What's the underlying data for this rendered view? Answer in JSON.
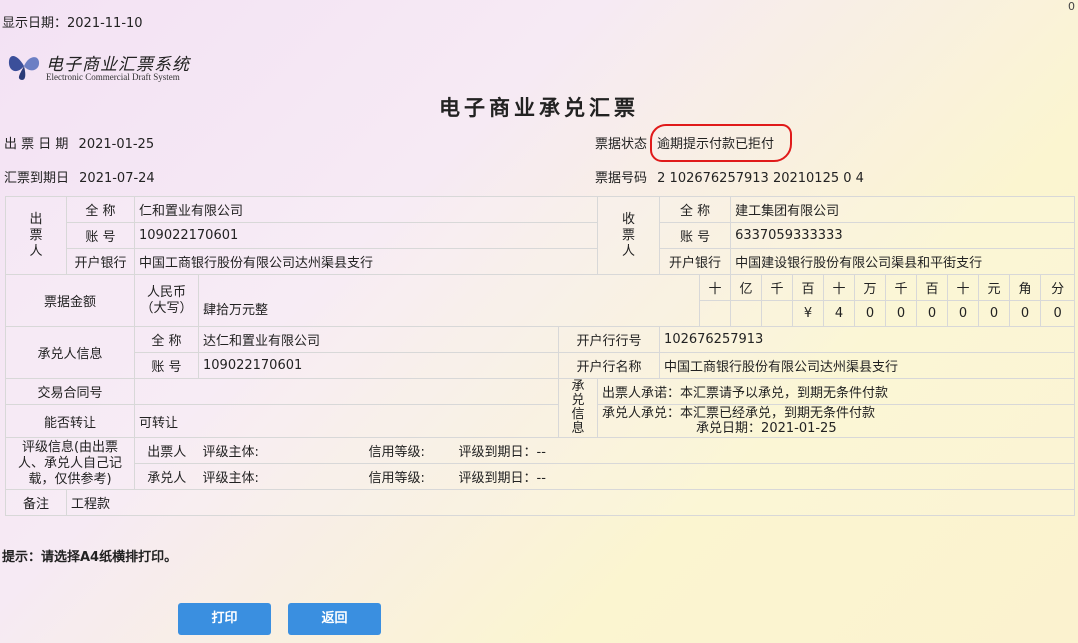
{
  "corner_mark": "0",
  "display_date": "显示日期：2021-11-10",
  "logo": {
    "cn": "电子商业汇票系统",
    "en": "Electronic Commercial Draft System"
  },
  "title": "电子商业承兑汇票",
  "issue_date_label": "出 票 日 期",
  "issue_date": "2021-01-25",
  "due_date_label": "汇票到期日",
  "due_date": "2021-07-24",
  "status_label": "票据状态",
  "status_value": "逾期提示付款已拒付",
  "number_label": "票据号码",
  "number_value": "2 102676257913 20210125 0        4",
  "drawer": {
    "header": [
      "出",
      "票",
      "人"
    ],
    "name_label": "全  称",
    "name": "        仁和置业有限公司",
    "account_label": "账  号",
    "account": "        109022170601",
    "bank_label": "开户银行",
    "bank": "中国工商银行股份有限公司达州渠县支行"
  },
  "payee": {
    "header": [
      "收",
      "票",
      "人"
    ],
    "name_label": "全  称",
    "name": "        建工集团有限公司",
    "account_label": "账  号",
    "account": "       6337059333333",
    "bank_label": "开户银行",
    "bank": "中国建设银行股份有限公司渠县和平街支行"
  },
  "amount": {
    "label": "票据金额",
    "currency_label": "人民币",
    "currency_sub": "（大写）",
    "text": "肆拾万元整",
    "unit_headers": [
      "十",
      "亿",
      "千",
      "百",
      "十",
      "万",
      "千",
      "百",
      "十",
      "元",
      "角",
      "分"
    ],
    "digits": [
      "",
      "",
      "",
      "¥",
      "4",
      "0",
      "0",
      "0",
      "0",
      "0",
      "0",
      "0"
    ]
  },
  "acceptor": {
    "label": "承兑人信息",
    "name_label": "全  称",
    "name": "        达仁和置业有限公司",
    "account_label": "账  号",
    "account": "        109022170601",
    "bank_no_label": "开户行行号",
    "bank_no": "102676257913",
    "bank_name_label": "开户行名称",
    "bank_name": "中国工商银行股份有限公司达州渠县支行"
  },
  "contract_label": "交易合同号",
  "contract_value": "",
  "transfer_label": "能否转让",
  "transfer_value": "可转让",
  "acceptance": {
    "header": [
      "承",
      "兑",
      "信",
      "息"
    ],
    "drawer_promise": "出票人承诺：本汇票请予以承兑，到期无条件付款",
    "acceptor_promise": "承兑人承兑：本汇票已经承兑，到期无条件付款",
    "accept_date": "承兑日期：2021-01-25"
  },
  "rating": {
    "label": "评级信息(由出票人、承兑人自己记载，仅供参考)",
    "rows": [
      {
        "role": "出票人",
        "subject": "评级主体:",
        "grade": "信用等级:",
        "expiry": "评级到期日：--"
      },
      {
        "role": "承兑人",
        "subject": "评级主体:",
        "grade": "信用等级:",
        "expiry": "评级到期日：--"
      }
    ]
  },
  "remark_label": "备注",
  "remark_value": "工程款",
  "tip": "提示：请选择A4纸横排打印。",
  "buttons": {
    "print": "打印",
    "back": "返回"
  }
}
